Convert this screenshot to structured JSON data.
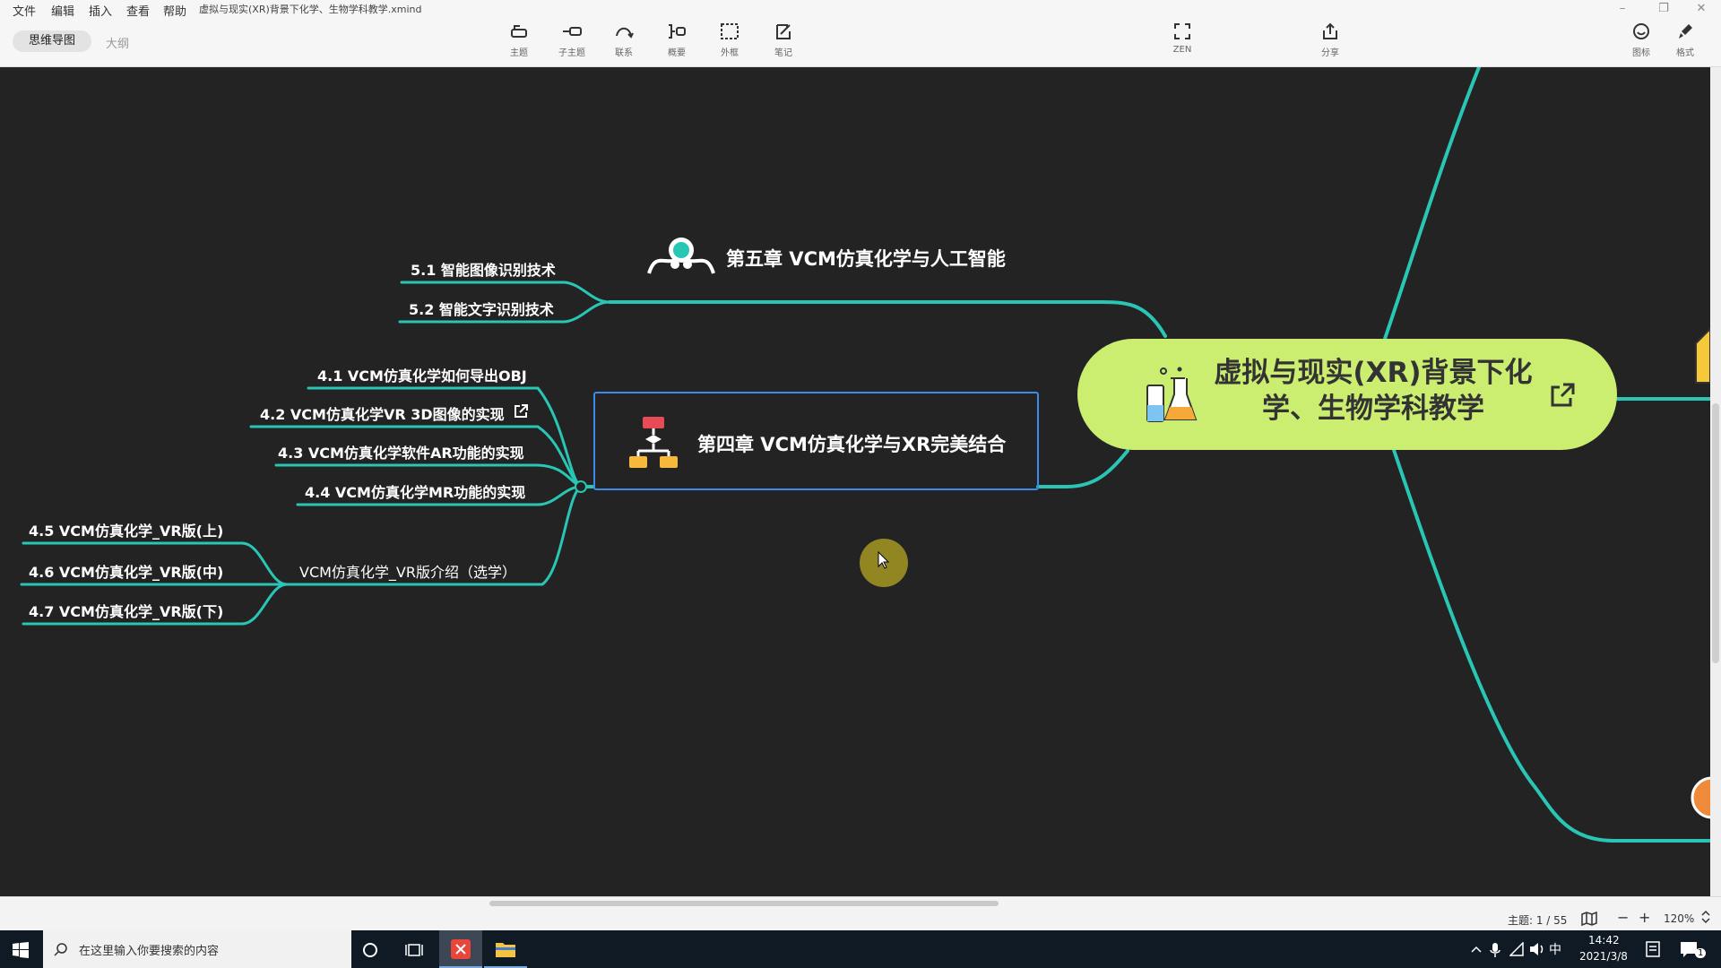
{
  "menu": {
    "items": [
      "文件",
      "编辑",
      "插入",
      "查看",
      "帮助"
    ]
  },
  "document": {
    "title": "虚拟与现实(XR)背景下化学、生物学科教学.xmind"
  },
  "window": {
    "minimize": "–",
    "restore": "❐",
    "close": "✕"
  },
  "view": {
    "mindmap": "思维导图",
    "outline": "大纲"
  },
  "toolbar": {
    "topic": "主题",
    "subtopic": "子主题",
    "relationship": "联系",
    "summary": "概要",
    "boundary": "外框",
    "note": "笔记",
    "zen": "ZEN",
    "share": "分享",
    "icon": "图标",
    "format": "格式"
  },
  "map": {
    "central": "虚拟与现实(XR)背景下化学、生物学科教学",
    "chapter5": {
      "title": "第五章  VCM仿真化学与人工智能",
      "items": [
        "5.1  智能图像识别技术",
        "5.2  智能文字识别技术"
      ]
    },
    "chapter4": {
      "title": "第四章  VCM仿真化学与XR完美结合",
      "items": [
        "4.1  VCM仿真化学如何导出OBJ",
        "4.2 VCM仿真化学VR 3D图像的实现",
        "4.3  VCM仿真化学软件AR功能的实现",
        "4.4  VCM仿真化学MR功能的实现"
      ],
      "vr_group": "VCM仿真化学_VR版介绍（选学）",
      "vr_items": [
        "4.5  VCM仿真化学_VR版(上)",
        "4.6  VCM仿真化学_VR版(中)",
        "4.7  VCM仿真化学_VR版(下)"
      ]
    }
  },
  "status": {
    "topic_count": "主题: 1 / 55",
    "zoom": "120%",
    "zoom_out": "−",
    "zoom_in": "+"
  },
  "taskbar": {
    "search_placeholder": "在这里输入你要搜索的内容",
    "time": "14:42",
    "date": "2021/3/8",
    "ime": "中",
    "notif_count": "1"
  },
  "colors": {
    "branch": "#29c5b5",
    "central": "#cbee70",
    "canvas": "#232323",
    "select": "#3b8be8"
  }
}
